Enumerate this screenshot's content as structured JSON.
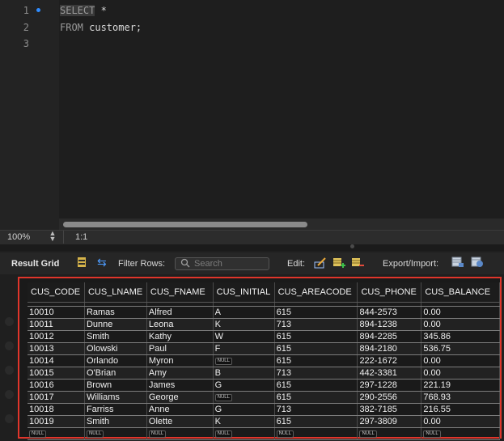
{
  "editor": {
    "lines": [
      {
        "num": "1",
        "keyword": "SELECT",
        "rest": " *"
      },
      {
        "num": "2",
        "keyword": "FROM",
        "rest": " customer;"
      },
      {
        "num": "3",
        "keyword": "",
        "rest": ""
      }
    ]
  },
  "status": {
    "zoom": "100%",
    "position": "1:1"
  },
  "result_toolbar": {
    "title": "Result Grid",
    "filter_label": "Filter Rows:",
    "search_placeholder": "Search",
    "edit_label": "Edit:",
    "export_label": "Export/Import:"
  },
  "grid": {
    "columns": [
      "CUS_CODE",
      "CUS_LNAME",
      "CUS_FNAME",
      "CUS_INITIAL",
      "CUS_AREACODE",
      "CUS_PHONE",
      "CUS_BALANCE"
    ],
    "rows": [
      [
        "10010",
        "Ramas",
        "Alfred",
        "A",
        "615",
        "844-2573",
        "0.00"
      ],
      [
        "10011",
        "Dunne",
        "Leona",
        "K",
        "713",
        "894-1238",
        "0.00"
      ],
      [
        "10012",
        "Smith",
        "Kathy",
        "W",
        "615",
        "894-2285",
        "345.86"
      ],
      [
        "10013",
        "Olowski",
        "Paul",
        "F",
        "615",
        "894-2180",
        "536.75"
      ],
      [
        "10014",
        "Orlando",
        "Myron",
        "NULL",
        "615",
        "222-1672",
        "0.00"
      ],
      [
        "10015",
        "O'Brian",
        "Amy",
        "B",
        "713",
        "442-3381",
        "0.00"
      ],
      [
        "10016",
        "Brown",
        "James",
        "G",
        "615",
        "297-1228",
        "221.19"
      ],
      [
        "10017",
        "Williams",
        "George",
        "NULL",
        "615",
        "290-2556",
        "768.93"
      ],
      [
        "10018",
        "Farriss",
        "Anne",
        "G",
        "713",
        "382-7185",
        "216.55"
      ],
      [
        "10019",
        "Smith",
        "Olette",
        "K",
        "615",
        "297-3809",
        "0.00"
      ],
      [
        "NULL",
        "NULL",
        "NULL",
        "NULL",
        "NULL",
        "NULL",
        "NULL"
      ]
    ]
  },
  "colors": {
    "accent": "#2f8cff",
    "highlight_border": "#e0352b"
  }
}
